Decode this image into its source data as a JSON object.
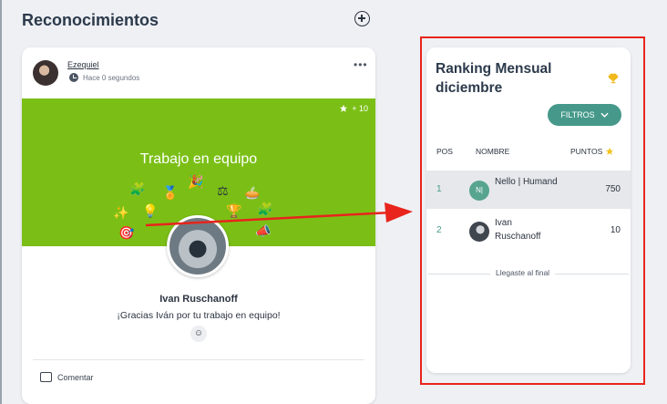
{
  "header": {
    "title": "Reconocimientos"
  },
  "card": {
    "author": "Ezequiel",
    "time": "Hace 0 segundos",
    "more": "•••",
    "points": "+ 10",
    "banner_title": "Trabajo en equipo",
    "recipient": "Ivan Ruschanoff",
    "message": "¡Gracias Iván por tu trabajo en equipo!",
    "comment_label": "Comentar"
  },
  "ranking": {
    "title": "Ranking Mensual diciembre",
    "filter_label": "FILTROS",
    "columns": {
      "pos": "POS",
      "name": "NOMBRE",
      "points": "PUNTOS"
    },
    "rows": [
      {
        "pos": "1",
        "initials": "N|",
        "name": "Nello | Humand",
        "points": "750"
      },
      {
        "pos": "2",
        "initials": "",
        "name": "Ivan Ruschanoff",
        "points": "10"
      }
    ],
    "end_text": "Llegaste al final"
  },
  "colors": {
    "accent": "#46998a",
    "banner": "#7bbf16",
    "highlight": "#e8241c"
  }
}
